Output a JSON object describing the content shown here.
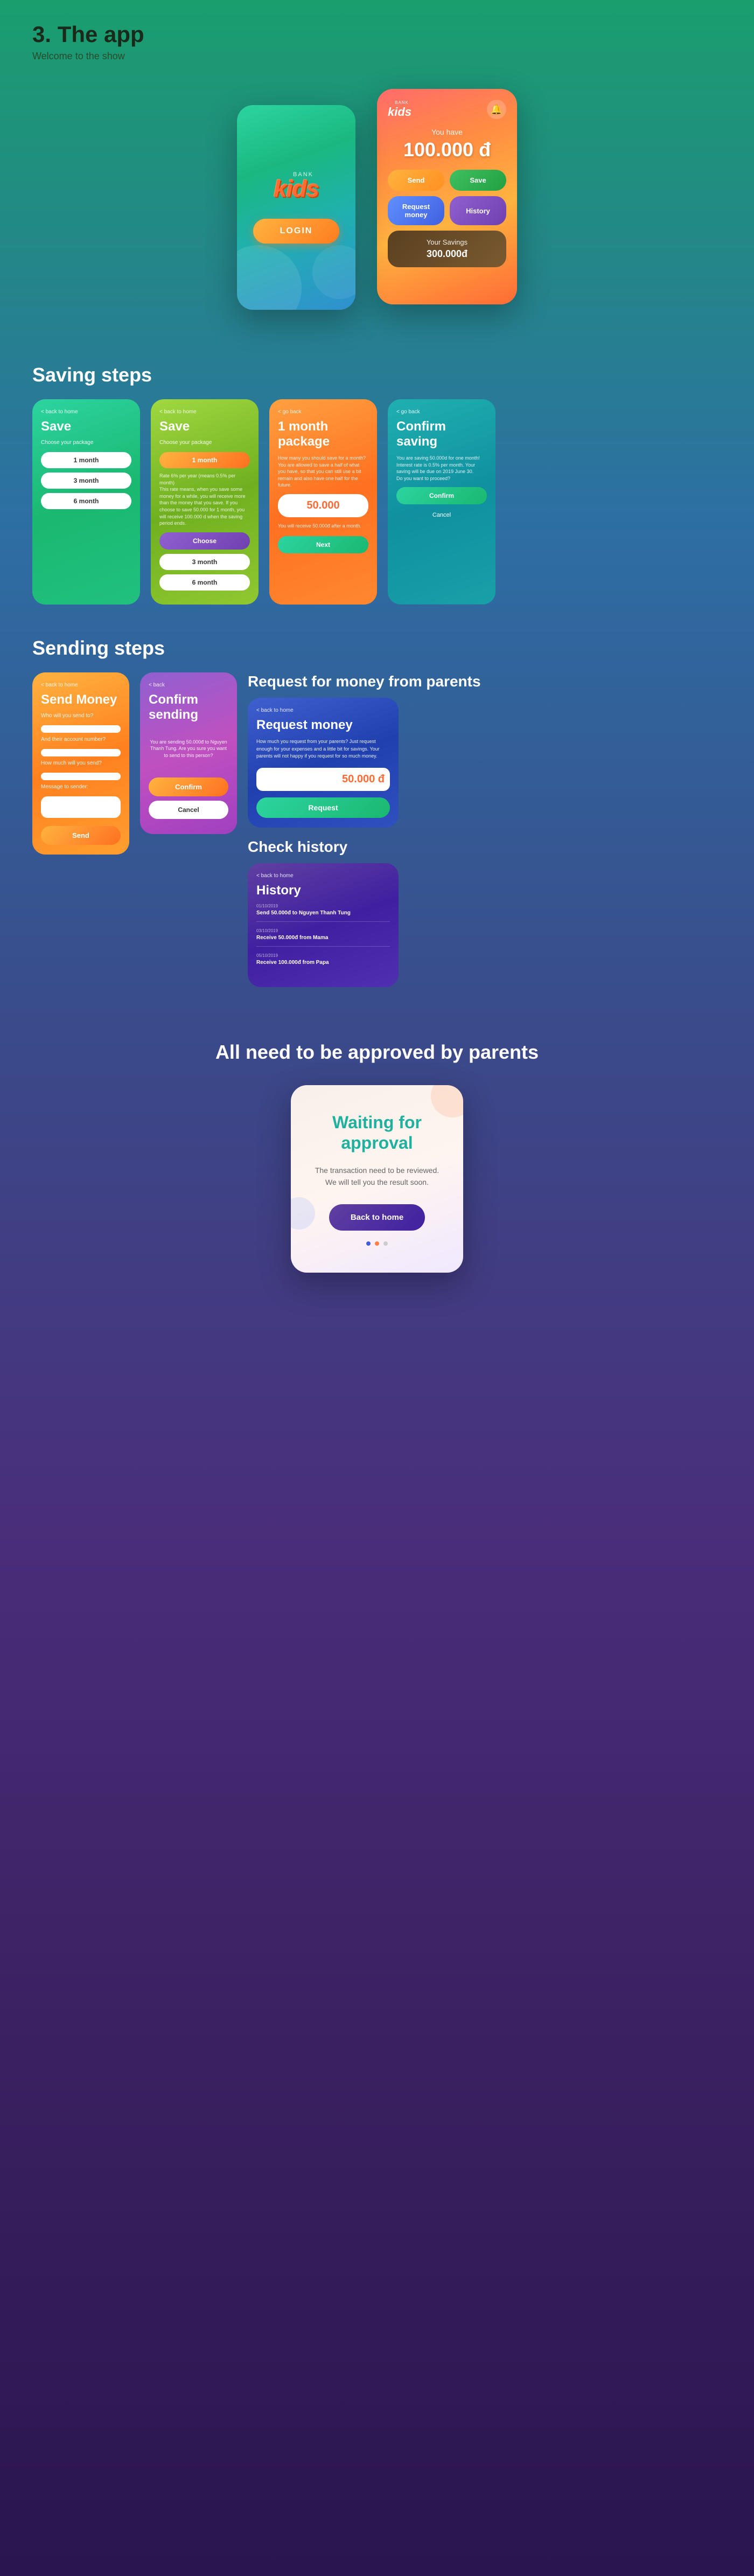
{
  "header": {
    "number": "3.",
    "title": "The app",
    "subtitle": "Welcome to the show"
  },
  "login_screen": {
    "logo_bank": "bank",
    "logo_kids": "kids",
    "login_button": "LOGIN"
  },
  "main_screen": {
    "logo_bank": "bank",
    "logo_kids": "kids",
    "bell_icon": "🔔",
    "you_have": "You have",
    "balance": "100.000 đ",
    "send_label": "Send",
    "save_label": "Save",
    "request_label": "Request money",
    "history_label": "History",
    "savings_title": "Your Savings",
    "savings_amount": "300.000đ"
  },
  "saving_steps": {
    "heading": "Saving steps",
    "card1": {
      "back": "< back to home",
      "title": "Save",
      "subtitle": "Choose your package",
      "option1": "1 month",
      "option2": "3 month",
      "option3": "6 month"
    },
    "card2": {
      "back": "< back to home",
      "title": "Save",
      "subtitle": "Choose your package",
      "option1": "1 month",
      "description": "Rate 6% per year (means 0.5% per month)\nThis rate means, when you save some money for a while, you will receive more than the money that you save. If you choose to save 50.000 for 1 month, you will receive 100.000 d when the saving period ends.",
      "option2": "3 month",
      "option3": "6 month"
    },
    "card3": {
      "back": "< go back",
      "title": "1 month package",
      "description": "How many you should save for a month?\nYou are allowed to save a half of what you have, so that you can still use a bit remain and also have one half for the future.",
      "amount": "50.000",
      "receive_text": "You will receive 50.000đ after a month.",
      "next_btn": "Next"
    },
    "card4": {
      "back": "< go back",
      "title": "Confirm saving",
      "description": "You are saving 50.000d for one month! Interest rate is 0.5% per month. Your saving will be due on 2019 June 30. Do you want to proceed?",
      "confirm_btn": "Confirm",
      "cancel_btn": "Cancel"
    }
  },
  "sending_steps": {
    "heading": "Sending steps",
    "send_card": {
      "back": "< back to home",
      "title": "Send Money",
      "who_label": "Who will you send to?",
      "account_label": "And their account number?",
      "amount_label": "How much will you send?",
      "message_label": "Message to sender:",
      "send_btn": "Send"
    },
    "confirm_card": {
      "back": "< back",
      "title": "Confirm sending",
      "description": "You are sending 50.000đ to Nguyen Thanh Tung. Are you sure you want to send to this person?",
      "confirm_btn": "Confirm",
      "cancel_btn": "Cancel"
    },
    "request_section_title": "Request for money from parents",
    "request_card": {
      "back": "< back to home",
      "title": "Request money",
      "description": "How much you request from your parents? Just request enough for your expenses and a little bit for savings. Your parents will not happy if you request for so much money.",
      "amount": "50.000",
      "currency": "đ",
      "request_btn": "Request"
    },
    "history_section_title": "Check history",
    "history_card": {
      "back": "< back to home",
      "title": "History",
      "entries": [
        {
          "date": "01/10/2019",
          "text": "Send 50.000đ to Nguyen Thanh Tung"
        },
        {
          "date": "03/10/2019",
          "text": "Receive 50.000đ from Mama"
        },
        {
          "date": "05/10/2019",
          "text": "Receive 100.000đ from Papa"
        }
      ]
    }
  },
  "approval": {
    "title": "All need to be approved by parents",
    "waiting_text": "Waiting for approval",
    "description": "The transaction need to be reviewed. We will tell you the result soon.",
    "back_home_btn": "Back to home"
  }
}
